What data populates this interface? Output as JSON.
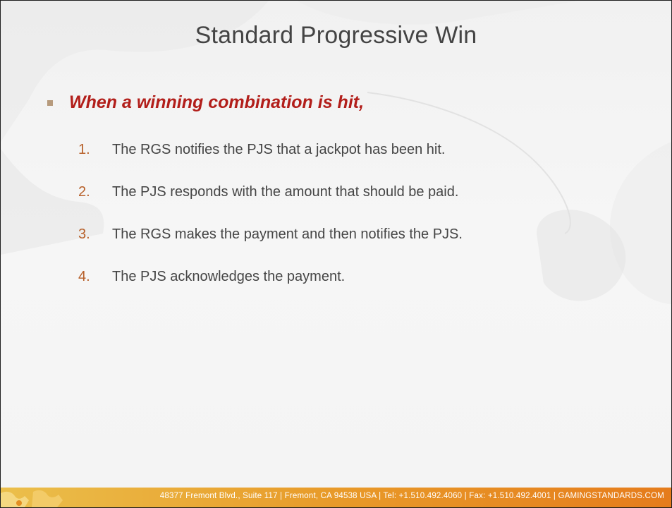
{
  "slide": {
    "title": "Standard Progressive Win",
    "lead": "When a winning combination is hit,",
    "steps": [
      {
        "number": "1.",
        "text": "The RGS notifies the PJS that a jackpot has been hit."
      },
      {
        "number": "2.",
        "text": "The PJS responds with the amount that should be paid."
      },
      {
        "number": "3.",
        "text": "The RGS makes the payment and then notifies the PJS."
      },
      {
        "number": "4.",
        "text": "The PJS acknowledges the payment."
      }
    ]
  },
  "footer": {
    "address": "48377 Fremont Blvd., Suite 117  |  Fremont, CA 94538  USA  |  Tel: +1.510.492.4060  |  Fax: +1.510.492.4001  |  GAMINGSTANDARDS.COM"
  },
  "colors": {
    "title": "#444444",
    "lead": "#b21e1a",
    "step_number": "#b7602a",
    "bullet": "#b69a7c",
    "footer_start": "#ebbf4b",
    "footer_end": "#e57c1c"
  }
}
